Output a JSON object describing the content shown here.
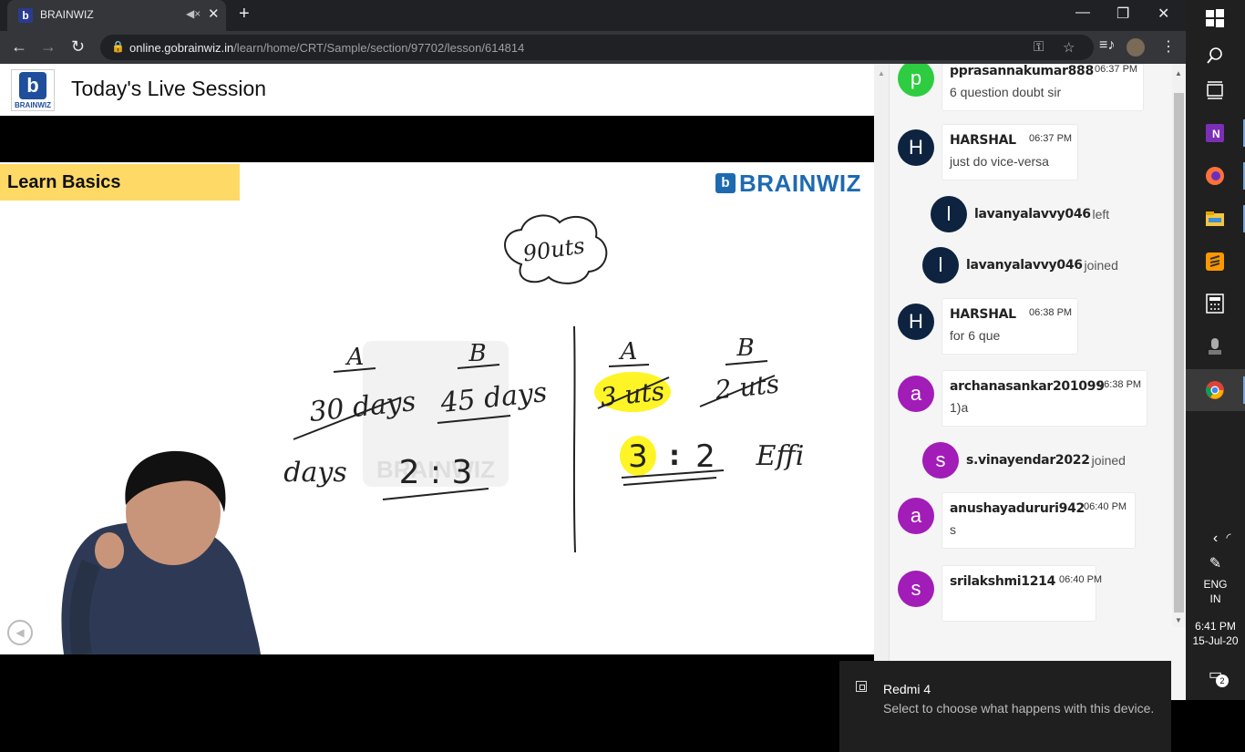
{
  "browser": {
    "tab_title": "BRAINWIZ",
    "favicon_letter": "b",
    "url_host": "online.gobrainwiz.in",
    "url_path": "/learn/home/CRT/Sample/section/97702/lesson/614814"
  },
  "site": {
    "logo_text": "BRAINWIZ",
    "logo_letter": "b",
    "title": "Today's Live Session"
  },
  "slide": {
    "heading": "Learn Basics",
    "brand": "BRAINWIZ",
    "brand_letter": "b",
    "watermark": "BRAINWIZ"
  },
  "whiteboard": {
    "cloud_text": "90uts",
    "left": {
      "col_a": "A",
      "col_b": "B",
      "val_a": "30 days",
      "val_b": "45 days",
      "row_label": "days",
      "ratio": "2 : 3"
    },
    "right": {
      "col_a": "A",
      "col_b": "B",
      "val_a": "3 uts",
      "val_b": "2 uts",
      "ratio_a": "3",
      "ratio_sep": ":",
      "ratio_b": "2",
      "note": "Effi"
    }
  },
  "chat": {
    "messages": [
      {
        "type": "msg",
        "avatar": "p",
        "color": "#2ecc40",
        "author": "pprasannakumar888",
        "time": "06:37 PM",
        "text": "6 question doubt sir"
      },
      {
        "type": "msg",
        "avatar": "H",
        "color": "#0d2340",
        "author": "HARSHAL",
        "time": "06:37 PM",
        "text": "just do vice-versa"
      },
      {
        "type": "event",
        "avatar": "l",
        "color": "#0d2340",
        "author": "lavanyalavvy046",
        "status": "left"
      },
      {
        "type": "event",
        "avatar": "l",
        "color": "#0d2340",
        "author": "lavanyalavvy046",
        "status": "joined"
      },
      {
        "type": "msg",
        "avatar": "H",
        "color": "#0d2340",
        "author": "HARSHAL",
        "time": "06:38 PM",
        "text": "for 6 que"
      },
      {
        "type": "msg",
        "avatar": "a",
        "color": "#a21cb8",
        "author": "archanasankar201099",
        "time": "06:38 PM",
        "text": "1)a"
      },
      {
        "type": "event",
        "avatar": "s",
        "color": "#a21cb8",
        "author": "s.vinayendar2022",
        "status": "joined"
      },
      {
        "type": "msg",
        "avatar": "a",
        "color": "#a21cb8",
        "author": "anushayadururi942",
        "time": "06:40 PM",
        "text": "s"
      },
      {
        "type": "msg",
        "avatar": "s",
        "color": "#a21cb8",
        "author": "srilakshmi1214",
        "time": "06:40 PM",
        "text": ""
      }
    ]
  },
  "toast": {
    "title": "Redmi 4",
    "body": "Select to choose what happens with this device."
  },
  "taskbar": {
    "language": "ENG",
    "region": "IN",
    "time": "6:41 PM",
    "date": "15-Jul-20",
    "notification_count": "2"
  }
}
